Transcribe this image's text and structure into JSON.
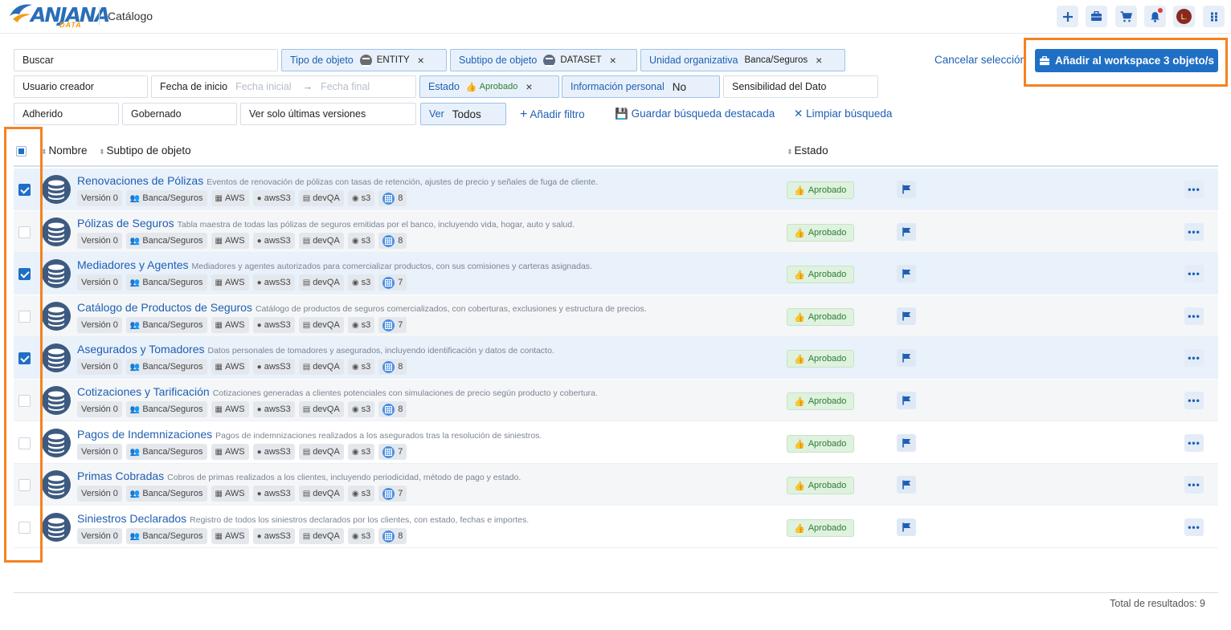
{
  "header": {
    "logo_text": "ANJANA",
    "logo_sub": "DATA",
    "title": "Catálogo"
  },
  "filters": {
    "search": "Buscar",
    "object_type_label": "Tipo de objeto",
    "object_type_value": "ENTITY",
    "object_subtype_label": "Subtipo de objeto",
    "object_subtype_value": "DATASET",
    "org_unit_label": "Unidad organizativa",
    "org_unit_value": "Banca/Seguros",
    "creator_user": "Usuario creador",
    "start_date_label": "Fecha de inicio",
    "start_date_placeholder": "Fecha inicial",
    "end_date_placeholder": "Fecha final",
    "state_label": "Estado",
    "state_value": "Aprobado",
    "personal_info_label": "Información personal",
    "personal_info_value": "No",
    "sensitivity": "Sensibilidad del Dato",
    "adhered": "Adherido",
    "governed": "Gobernado",
    "latest_versions": "Ver solo últimas versiones",
    "view_label": "Ver",
    "view_value": "Todos",
    "add_filter": "Añadir filtro",
    "save_search": "Guardar búsqueda destacada",
    "clear_search": "Limpiar búsqueda",
    "cancel_selection": "Cancelar selección",
    "add_workspace": "Añadir al workspace 3 objeto/s"
  },
  "table": {
    "col_name": "Nombre",
    "col_subtype": "Subtipo de objeto",
    "col_state": "Estado",
    "rows": [
      {
        "title": "Renovaciones de Pólizas",
        "desc": "Eventos de renovación de pólizas con tasas de retención, ajustes de precio y señales de fuga de cliente.",
        "version": "Versión 0",
        "org": "Banca/Seguros",
        "cloud": "AWS",
        "service": "awsS3",
        "env": "devQA",
        "loc": "s3",
        "count": "8",
        "status": "Aprobado",
        "checked": true
      },
      {
        "title": "Pólizas de Seguros",
        "desc": "Tabla maestra de todas las pólizas de seguros emitidas por el banco, incluyendo vida, hogar, auto y salud.",
        "version": "Versión 0",
        "org": "Banca/Seguros",
        "cloud": "AWS",
        "service": "awsS3",
        "env": "devQA",
        "loc": "s3",
        "count": "8",
        "status": "Aprobado",
        "checked": false
      },
      {
        "title": "Mediadores y Agentes",
        "desc": "Mediadores y agentes autorizados para comercializar productos, con sus comisiones y carteras asignadas.",
        "version": "Versión 0",
        "org": "Banca/Seguros",
        "cloud": "AWS",
        "service": "awsS3",
        "env": "devQA",
        "loc": "s3",
        "count": "7",
        "status": "Aprobado",
        "checked": true
      },
      {
        "title": "Catálogo de Productos de Seguros",
        "desc": "Catálogo de productos de seguros comercializados, con coberturas, exclusiones y estructura de precios.",
        "version": "Versión 0",
        "org": "Banca/Seguros",
        "cloud": "AWS",
        "service": "awsS3",
        "env": "devQA",
        "loc": "s3",
        "count": "7",
        "status": "Aprobado",
        "checked": false
      },
      {
        "title": "Asegurados y Tomadores",
        "desc": "Datos personales de tomadores y asegurados, incluyendo identificación y datos de contacto.",
        "version": "Versión 0",
        "org": "Banca/Seguros",
        "cloud": "AWS",
        "service": "awsS3",
        "env": "devQA",
        "loc": "s3",
        "count": "8",
        "status": "Aprobado",
        "checked": true
      },
      {
        "title": "Cotizaciones y Tarificación",
        "desc": "Cotizaciones generadas a clientes potenciales con simulaciones de precio según producto y cobertura.",
        "version": "Versión 0",
        "org": "Banca/Seguros",
        "cloud": "AWS",
        "service": "awsS3",
        "env": "devQA",
        "loc": "s3",
        "count": "8",
        "status": "Aprobado",
        "checked": false
      },
      {
        "title": "Pagos de Indemnizaciones",
        "desc": "Pagos de indemnizaciones realizados a los asegurados tras la resolución de siniestros.",
        "version": "Versión 0",
        "org": "Banca/Seguros",
        "cloud": "AWS",
        "service": "awsS3",
        "env": "devQA",
        "loc": "s3",
        "count": "7",
        "status": "Aprobado",
        "checked": false
      },
      {
        "title": "Primas Cobradas",
        "desc": "Cobros de primas realizados a los clientes, incluyendo periodicidad, método de pago y estado.",
        "version": "Versión 0",
        "org": "Banca/Seguros",
        "cloud": "AWS",
        "service": "awsS3",
        "env": "devQA",
        "loc": "s3",
        "count": "7",
        "status": "Aprobado",
        "checked": false
      },
      {
        "title": "Siniestros Declarados",
        "desc": "Registro de todos los siniestros declarados por los clientes, con estado, fechas e importes.",
        "version": "Versión 0",
        "org": "Banca/Seguros",
        "cloud": "AWS",
        "service": "awsS3",
        "env": "devQA",
        "loc": "s3",
        "count": "8",
        "status": "Aprobado",
        "checked": false
      }
    ]
  },
  "footer": {
    "total": "Total de resultados: 9"
  },
  "user": {
    "initial": "L."
  },
  "colors": {
    "primary": "#1f6fc5",
    "highlight": "#f58220",
    "approved": "#2e7d32"
  }
}
